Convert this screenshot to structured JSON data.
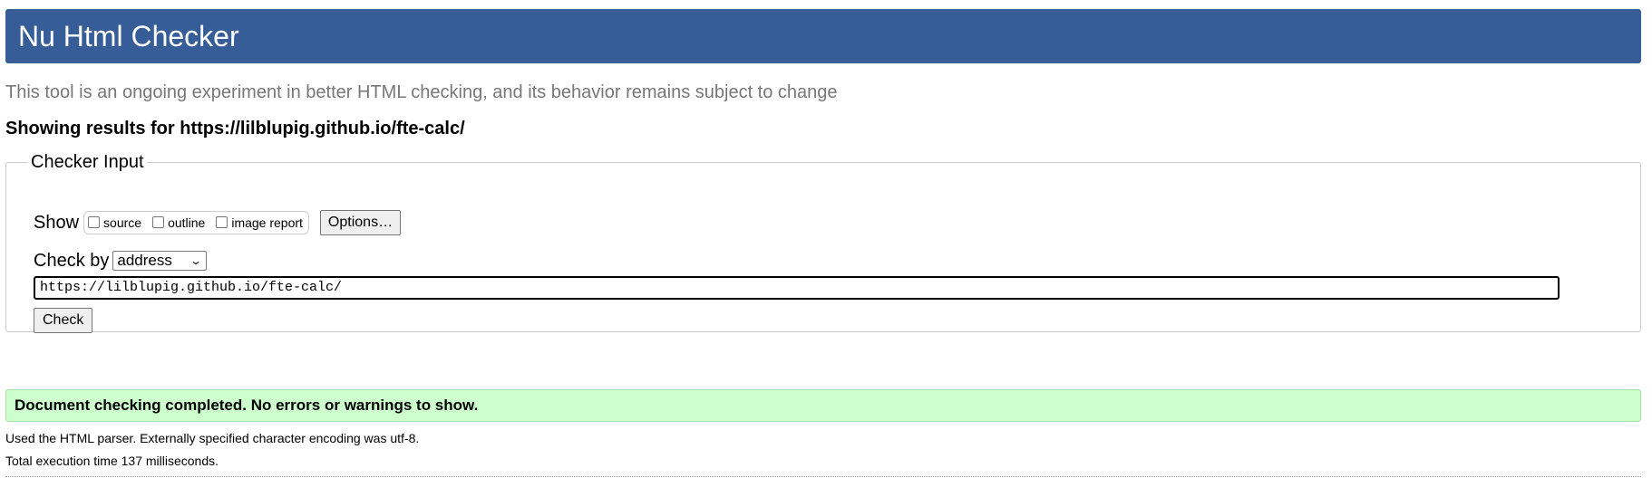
{
  "header": {
    "title": "Nu Html Checker",
    "background_color": "#365d98"
  },
  "subtitle": "This tool is an ongoing experiment in better HTML checking, and its behavior remains subject to change",
  "results_for": {
    "prefix": "Showing results for ",
    "url": "https://lilblupig.github.io/fte-calc/"
  },
  "checker_input": {
    "legend": "Checker Input",
    "show_label": "Show",
    "show_options": [
      {
        "label": "source",
        "checked": false
      },
      {
        "label": "outline",
        "checked": false
      },
      {
        "label": "image report",
        "checked": false
      }
    ],
    "options_button": "Options…",
    "check_by_label": "Check by",
    "check_by_selected": "address",
    "url_value": "https://lilblupig.github.io/fte-calc/",
    "check_button": "Check"
  },
  "result": {
    "message": "Document checking completed. No errors or warnings to show.",
    "color": "#ccffcc"
  },
  "info": {
    "parser_line": "Used the HTML parser. Externally specified character encoding was utf-8.",
    "execution_line": "Total execution time 137 milliseconds."
  }
}
